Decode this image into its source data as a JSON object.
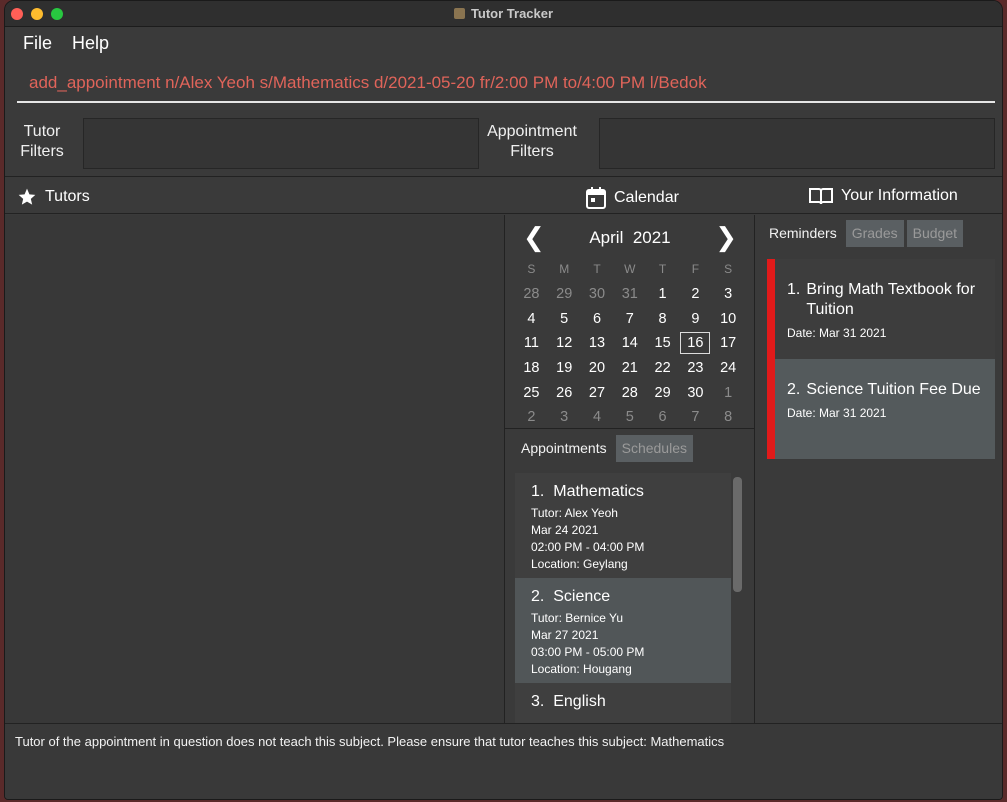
{
  "window": {
    "title": "Tutor Tracker"
  },
  "menu": {
    "file": "File",
    "help": "Help"
  },
  "command": {
    "value": "add_appointment n/Alex Yeoh s/Mathematics d/2021-05-20 fr/2:00 PM to/4:00 PM l/Bedok"
  },
  "filters": {
    "tutor_label_1": "Tutor",
    "tutor_label_2": "Filters",
    "appt_label_1": "Appointment",
    "appt_label_2": "Filters"
  },
  "sections": {
    "tutors": "Tutors",
    "calendar": "Calendar",
    "info": "Your Information"
  },
  "calendar": {
    "month": "April",
    "year": "2021",
    "days_of_week": [
      "S",
      "M",
      "T",
      "W",
      "T",
      "F",
      "S"
    ],
    "weeks": [
      [
        "28",
        "29",
        "30",
        "31",
        "1",
        "2",
        "3"
      ],
      [
        "4",
        "5",
        "6",
        "7",
        "8",
        "9",
        "10"
      ],
      [
        "11",
        "12",
        "13",
        "14",
        "15",
        "16",
        "17"
      ],
      [
        "18",
        "19",
        "20",
        "21",
        "22",
        "23",
        "24"
      ],
      [
        "25",
        "26",
        "27",
        "28",
        "29",
        "30",
        "1"
      ],
      [
        "2",
        "3",
        "4",
        "5",
        "6",
        "7",
        "8"
      ]
    ],
    "today": "16"
  },
  "appt_tabs": {
    "appointments": "Appointments",
    "schedules": "Schedules"
  },
  "appointments": [
    {
      "index": "1.",
      "subject": "Mathematics",
      "tutor": "Tutor: Alex Yeoh",
      "date": "Mar 24 2021",
      "time": "02:00 PM - 04:00 PM",
      "location": "Location: Geylang"
    },
    {
      "index": "2.",
      "subject": "Science",
      "tutor": "Tutor: Bernice Yu",
      "date": "Mar 27 2021",
      "time": "03:00 PM - 05:00 PM",
      "location": "Location: Hougang"
    },
    {
      "index": "3.",
      "subject": "English",
      "tutor": "",
      "date": "",
      "time": "",
      "location": ""
    }
  ],
  "info_tabs": {
    "reminders": "Reminders",
    "grades": "Grades",
    "budget": "Budget"
  },
  "reminders": [
    {
      "index": "1.",
      "title": "Bring Math Textbook for Tuition",
      "date": "Date:  Mar 31 2021"
    },
    {
      "index": "2.",
      "title": "Science Tuition Fee Due",
      "date": "Date:  Mar 31 2021"
    }
  ],
  "status": {
    "message": "Tutor of the appointment in question does not teach this subject. Please ensure that tutor teaches this subject: Mathematics"
  },
  "colors": {
    "command_text": "#e0645a",
    "reminder_bar": "#e11a1a"
  }
}
